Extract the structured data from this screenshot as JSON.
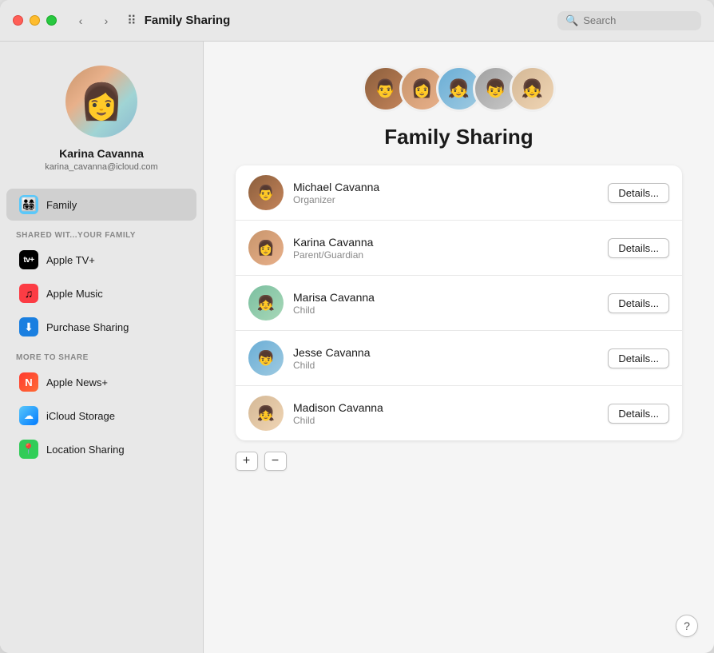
{
  "window": {
    "title": "Family Sharing"
  },
  "titlebar": {
    "title": "Family Sharing",
    "search_placeholder": "Search",
    "back_label": "‹",
    "forward_label": "›"
  },
  "sidebar": {
    "profile": {
      "name": "Karina Cavanna",
      "email": "karina_cavanna@icloud.com",
      "avatar_emoji": "👩"
    },
    "nav_item": {
      "label": "Family",
      "icon": "👨‍👩‍👧‍👦"
    },
    "shared_section_header": "SHARED WIT...YOUR FAMILY",
    "shared_items": [
      {
        "id": "appletv",
        "label": "Apple TV+",
        "icon": "tv"
      },
      {
        "id": "applemusic",
        "label": "Apple Music",
        "icon": "music"
      },
      {
        "id": "purchase",
        "label": "Purchase Sharing",
        "icon": "purchase"
      }
    ],
    "more_section_header": "MORE TO SHARE",
    "more_items": [
      {
        "id": "news",
        "label": "Apple News+",
        "icon": "news"
      },
      {
        "id": "icloud",
        "label": "iCloud Storage",
        "icon": "icloud"
      },
      {
        "id": "location",
        "label": "Location Sharing",
        "icon": "location"
      }
    ]
  },
  "main": {
    "panel_title": "Family Sharing",
    "members": [
      {
        "name": "Michael Cavanna",
        "role": "Organizer",
        "avatar": "mav1",
        "details_label": "Details..."
      },
      {
        "name": "Karina Cavanna",
        "role": "Parent/Guardian",
        "avatar": "mav2",
        "details_label": "Details..."
      },
      {
        "name": "Marisa Cavanna",
        "role": "Child",
        "avatar": "mav3",
        "details_label": "Details..."
      },
      {
        "name": "Jesse Cavanna",
        "role": "Child",
        "avatar": "mav4",
        "details_label": "Details..."
      },
      {
        "name": "Madison Cavanna",
        "role": "Child",
        "avatar": "mav5",
        "details_label": "Details..."
      }
    ],
    "add_label": "+",
    "remove_label": "−",
    "help_label": "?"
  }
}
